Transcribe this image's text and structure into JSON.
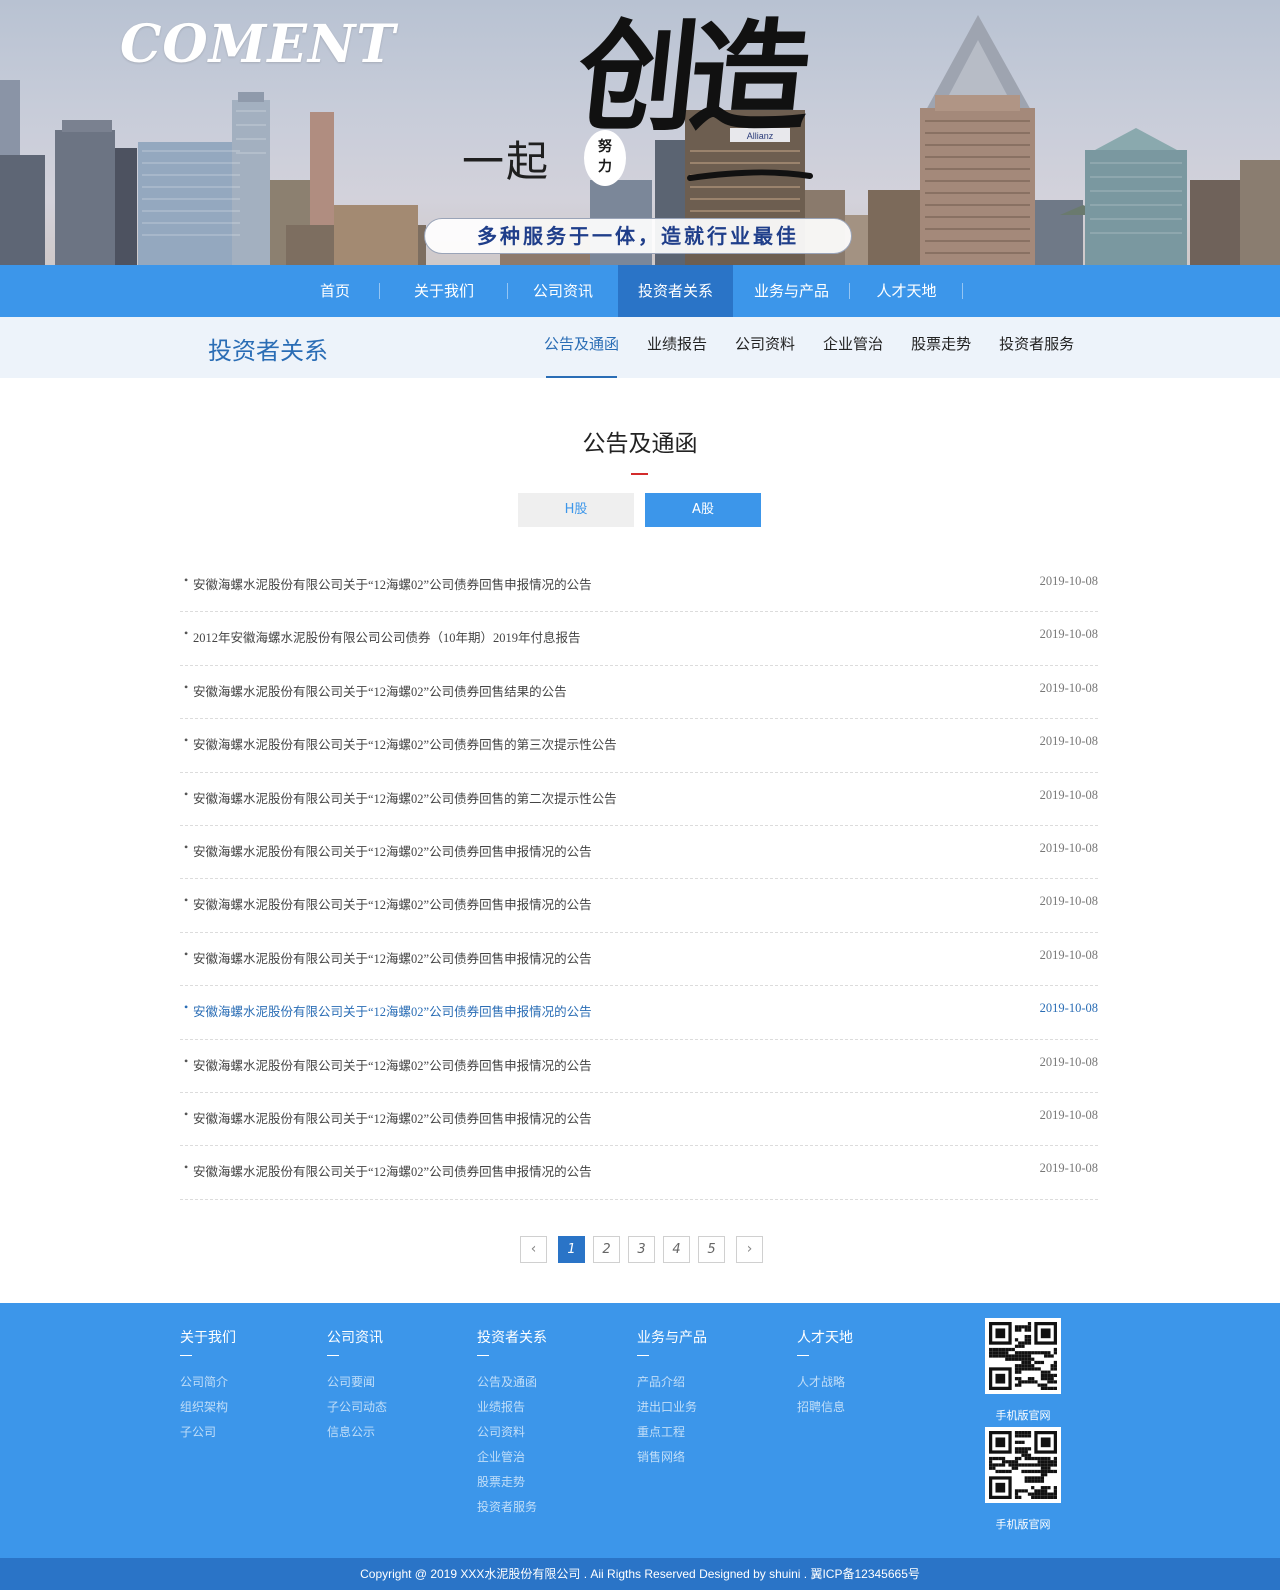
{
  "banner": {
    "brand": "COMENT",
    "headline_lead": "一起",
    "headline_big": "创造",
    "stamp": "努力",
    "slogan": "多种服务于一体，造就行业最佳",
    "billboard": "Allianz"
  },
  "main_nav": {
    "items": [
      {
        "label": "首页"
      },
      {
        "label": "关于我们"
      },
      {
        "label": "公司资讯"
      },
      {
        "label": "投资者关系",
        "active": true
      },
      {
        "label": "业务与产品"
      },
      {
        "label": "人才天地"
      }
    ]
  },
  "section": {
    "title": "投资者关系",
    "tabs": [
      {
        "label": "公告及通函",
        "active": true
      },
      {
        "label": "业绩报告"
      },
      {
        "label": "公司资料"
      },
      {
        "label": "企业管治"
      },
      {
        "label": "股票走势"
      },
      {
        "label": "投资者服务"
      }
    ]
  },
  "content": {
    "title": "公告及通函",
    "share_tabs": {
      "h": "H股",
      "a": "A股",
      "selected": "A股"
    },
    "bullet": "•",
    "news": [
      {
        "title": "安徽海螺水泥股份有限公司关于“12海螺02”公司债券回售申报情况的公告",
        "date": "2019-10-08"
      },
      {
        "title": "2012年安徽海螺水泥股份有限公司公司债券（10年期）2019年付息报告",
        "date": "2019-10-08"
      },
      {
        "title": "安徽海螺水泥股份有限公司关于“12海螺02”公司债券回售结果的公告",
        "date": "2019-10-08"
      },
      {
        "title": "安徽海螺水泥股份有限公司关于“12海螺02”公司债券回售的第三次提示性公告",
        "date": "2019-10-08"
      },
      {
        "title": "安徽海螺水泥股份有限公司关于“12海螺02”公司债券回售的第二次提示性公告",
        "date": "2019-10-08"
      },
      {
        "title": "安徽海螺水泥股份有限公司关于“12海螺02”公司债券回售申报情况的公告",
        "date": "2019-10-08"
      },
      {
        "title": "安徽海螺水泥股份有限公司关于“12海螺02”公司债券回售申报情况的公告",
        "date": "2019-10-08"
      },
      {
        "title": "安徽海螺水泥股份有限公司关于“12海螺02”公司债券回售申报情况的公告",
        "date": "2019-10-08"
      },
      {
        "title": "安徽海螺水泥股份有限公司关于“12海螺02”公司债券回售申报情况的公告",
        "date": "2019-10-08",
        "highlighted": true
      },
      {
        "title": "安徽海螺水泥股份有限公司关于“12海螺02”公司债券回售申报情况的公告",
        "date": "2019-10-08"
      },
      {
        "title": "安徽海螺水泥股份有限公司关于“12海螺02”公司债券回售申报情况的公告",
        "date": "2019-10-08"
      },
      {
        "title": "安徽海螺水泥股份有限公司关于“12海螺02”公司债券回售申报情况的公告",
        "date": "2019-10-08"
      }
    ]
  },
  "pagination": {
    "prev": "‹",
    "next": "›",
    "pages": [
      "1",
      "2",
      "3",
      "4",
      "5"
    ],
    "current": "1"
  },
  "footer": {
    "columns": [
      {
        "title": "关于我们",
        "links": [
          "公司简介",
          "组织架构",
          "子公司"
        ]
      },
      {
        "title": "公司资讯",
        "links": [
          "公司要闻",
          "子公司动态",
          "信息公示"
        ]
      },
      {
        "title": "投资者关系",
        "links": [
          "公告及通函",
          "业绩报告",
          "公司资料",
          "企业管治",
          "股票走势",
          "投资者服务"
        ]
      },
      {
        "title": "业务与产品",
        "links": [
          "产品介绍",
          "进出口业务",
          "重点工程",
          "销售网络"
        ]
      },
      {
        "title": "人才天地",
        "links": [
          "人才战略",
          "招聘信息"
        ]
      }
    ],
    "qr_codes": [
      {
        "caption": "手机版官网",
        "icon": "qr-code-icon"
      },
      {
        "caption": "手机版官网",
        "icon": "qr-code-icon"
      }
    ],
    "copyright": "Copyright @ 2019 XXX水泥股份有限公司 . Aii Rigths Reserved Designed by shuini . 翼ICP备12345665号"
  },
  "colors": {
    "primary_blue": "#3c96ea",
    "active_blue": "#2a74c7",
    "text_blue": "#2a6db5",
    "subheader_bg": "#edf3fa",
    "accent_red": "#d32b2b"
  }
}
